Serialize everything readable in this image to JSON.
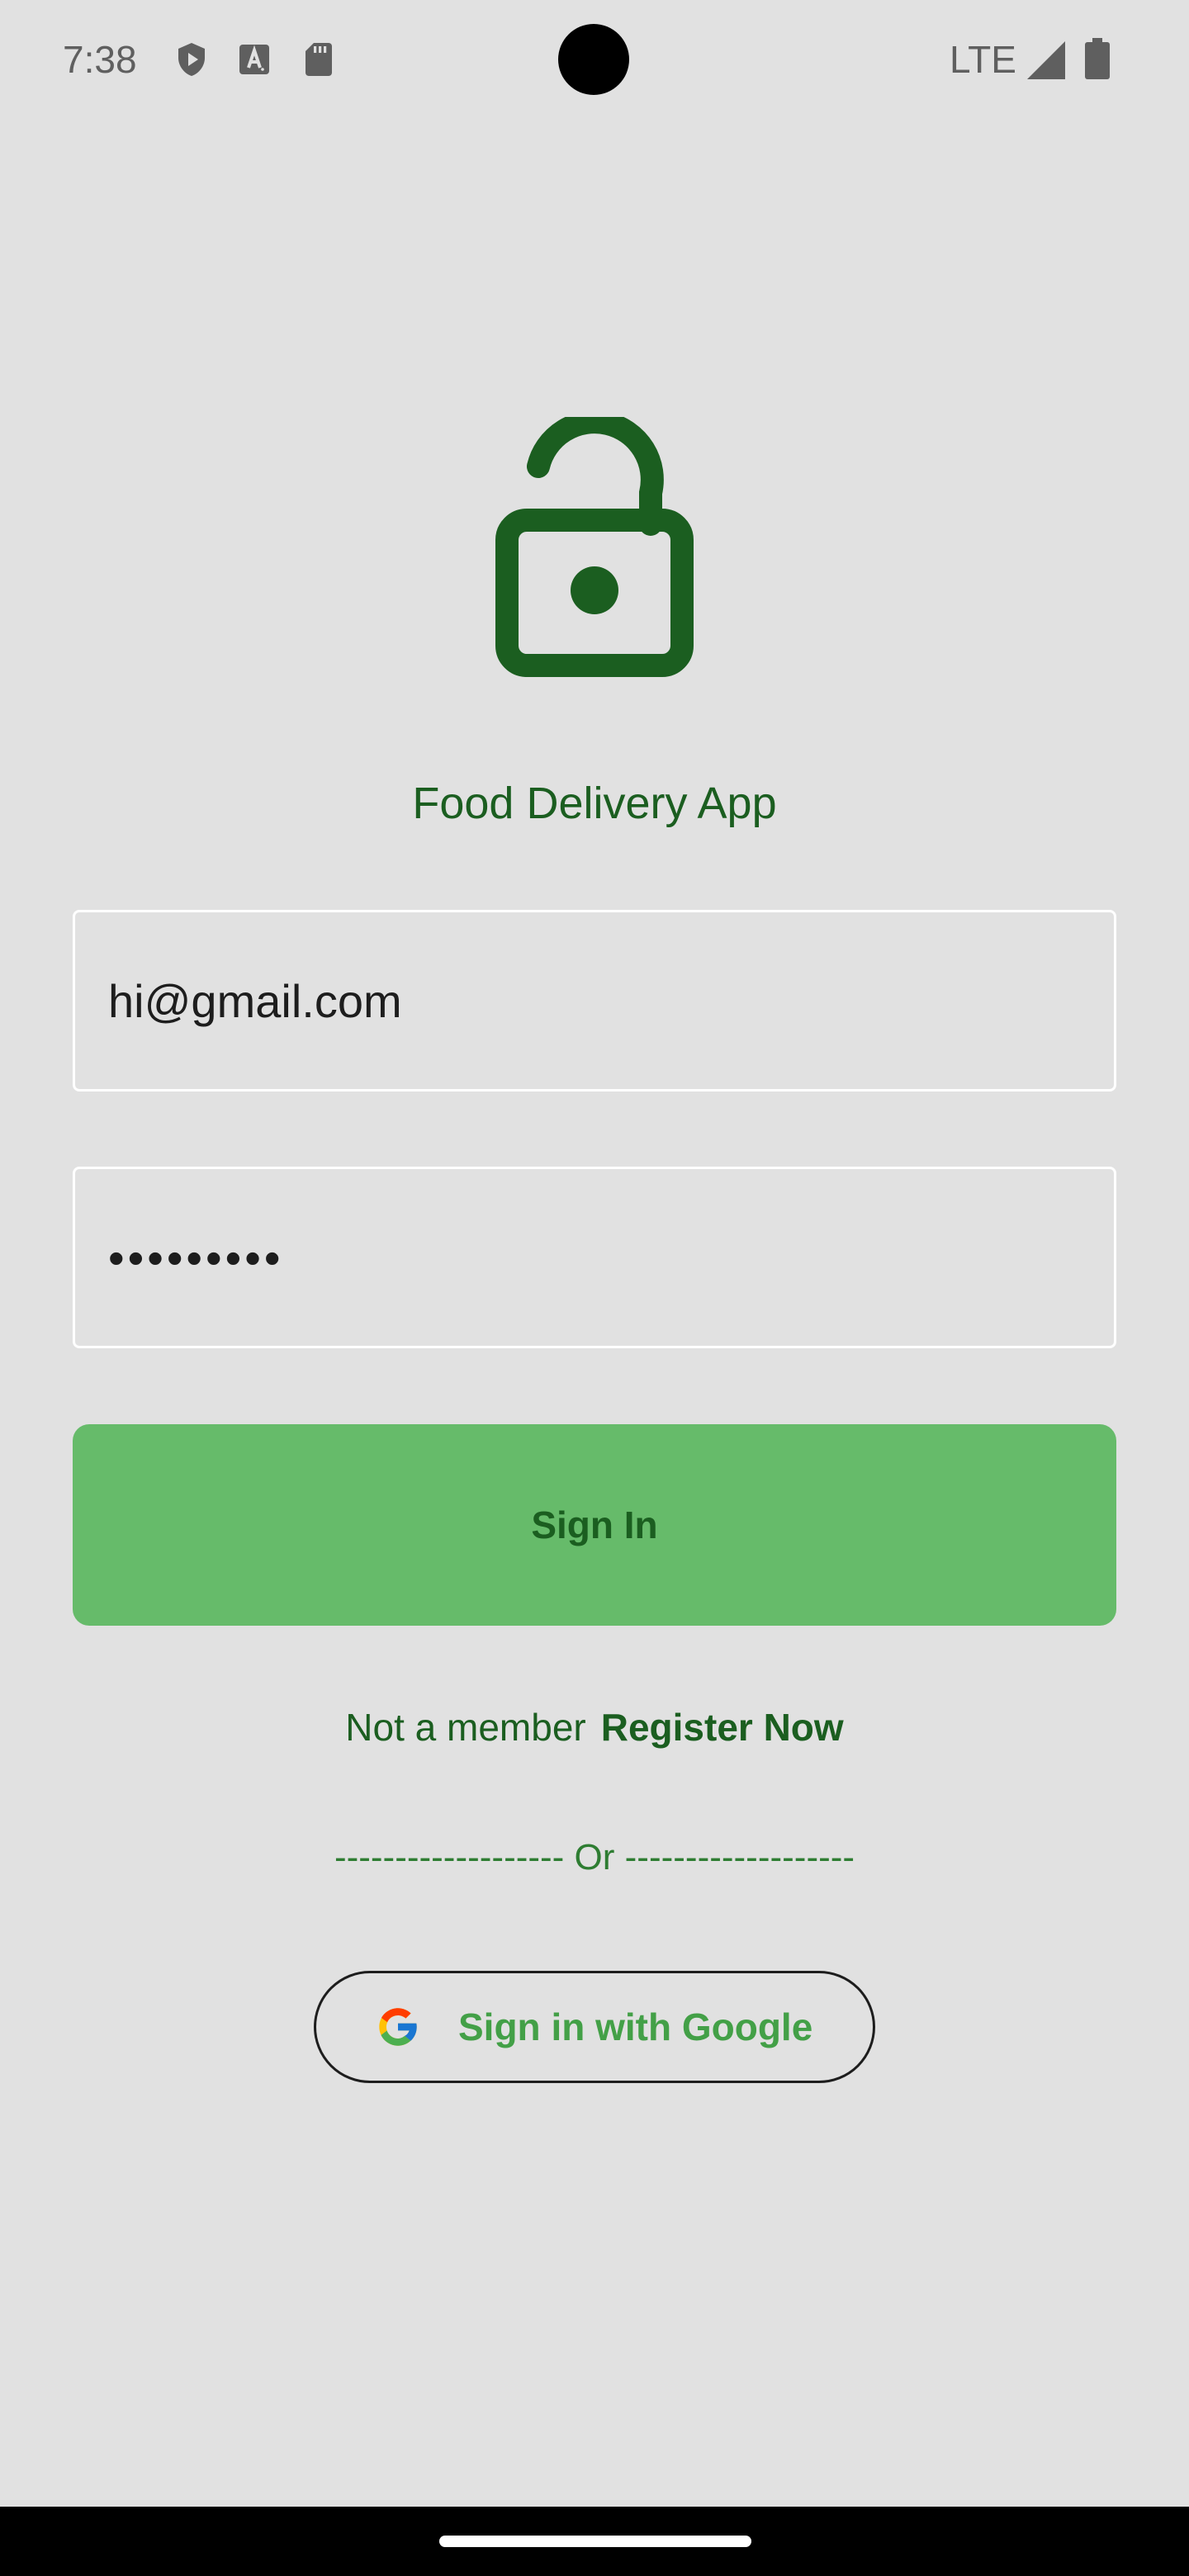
{
  "status_bar": {
    "time": "7:38",
    "network": "LTE",
    "icons": [
      "shield-play-icon",
      "font-a-icon",
      "sd-card-icon",
      "signal-icon",
      "battery-icon"
    ]
  },
  "login": {
    "lock_icon": "lock-open-icon",
    "app_title": "Food Delivery App",
    "email_value": "hi@gmail.com",
    "password_value": "•••••••••",
    "sign_in_label": "Sign In",
    "not_member_text": "Not a member",
    "register_label": "Register Now",
    "or_divider": "------------------- Or -------------------",
    "google_label": "Sign in with Google"
  },
  "colors": {
    "background": "#e1e1e1",
    "primary_dark": "#1b5e20",
    "button_green": "#66bb6a",
    "google_text": "#43a047"
  }
}
